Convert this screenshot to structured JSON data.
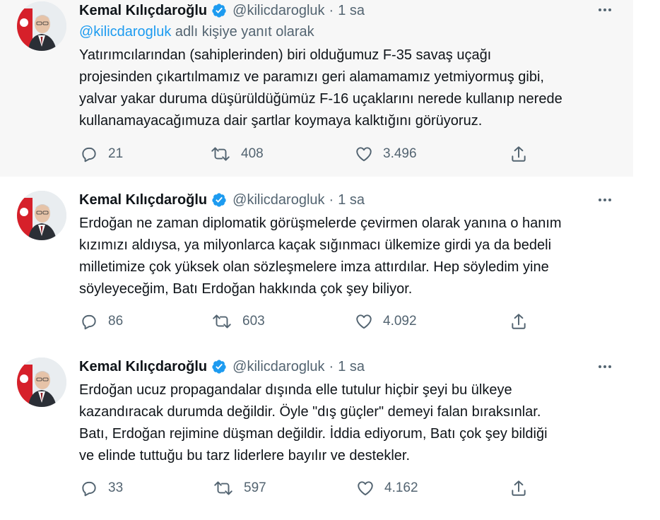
{
  "tweets": [
    {
      "name": "Kemal Kılıçdaroğlu",
      "handle": "@kilicdarogluk",
      "separator": "·",
      "time": "1 sa",
      "replying_mention": "@kilicdarogluk",
      "replying_rest": " adlı kişiye yanıt olarak",
      "text_lines": [
        "Yatırımcılarından (sahiplerinden) biri olduğumuz F-35 savaş uçağı",
        "projesinden çıkartılmamız ve paramızı geri alamamamız yetmiyormuş gibi,",
        "yalvar yakar duruma düşürüldüğümüz F-16 uçaklarını nerede kullanıp nerede",
        "kullanamayacağımuza dair şartlar koymaya kalktığını görüyoruz."
      ],
      "replies": "21",
      "retweets": "408",
      "likes": "3.496"
    },
    {
      "name": "Kemal Kılıçdaroğlu",
      "handle": "@kilicdarogluk",
      "separator": "·",
      "time": "1 sa",
      "text_lines": [
        "Erdoğan ne zaman diplomatik görüşmelerde çevirmen olarak yanına o hanım",
        "kızımızı aldıysa, ya milyonlarca kaçak sığınmacı ülkemize girdi ya da bedeli",
        "milletimize çok yüksek olan sözleşmelere imza attırdılar. Hep söyledim yine",
        "söyleyeceğim, Batı Erdoğan hakkında çok şey biliyor."
      ],
      "replies": "86",
      "retweets": "603",
      "likes": "4.092"
    },
    {
      "name": "Kemal Kılıçdaroğlu",
      "handle": "@kilicdarogluk",
      "separator": "·",
      "time": "1 sa",
      "text_lines": [
        "Erdoğan ucuz propagandalar dışında elle tutulur hiçbir şeyi bu ülkeye",
        "kazandıracak durumda değildir. Öyle \"dış güçler\" demeyi falan bıraksınlar.",
        "Batı, Erdoğan rejimine düşman değildir. İddia ediyorum, Batı çok şey bildiği",
        "ve elinde tuttuğu bu tarz liderlere bayılır ve destekler."
      ],
      "replies": "33",
      "retweets": "597",
      "likes": "4.162"
    }
  ],
  "icons": {
    "verified": "verified-badge-icon",
    "more": "more-horizontal-icon",
    "reply": "reply-icon",
    "retweet": "retweet-icon",
    "like": "heart-icon",
    "share": "share-icon"
  },
  "colors": {
    "accent": "#1d9bf0",
    "secondary_text": "#536471",
    "highlight_background": "#f7f7f7",
    "thread_line": "#cfd9de"
  }
}
